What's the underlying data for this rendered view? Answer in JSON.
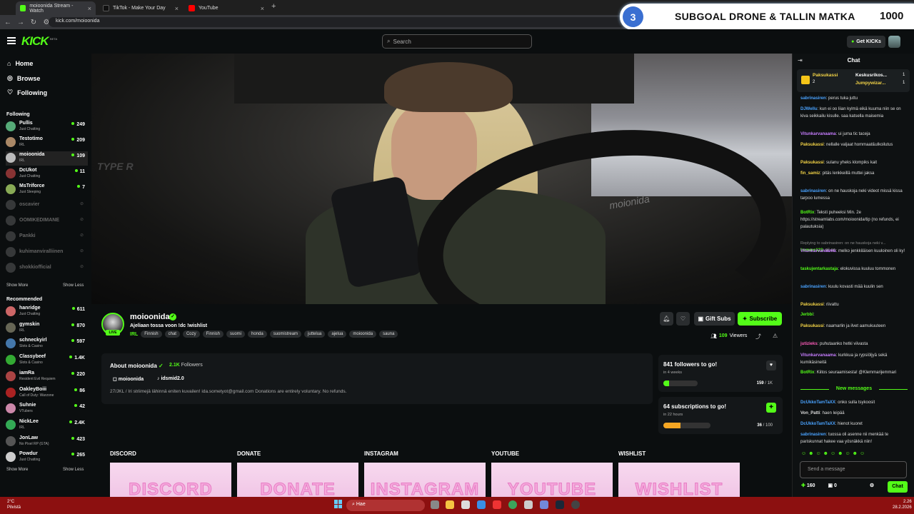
{
  "browser": {
    "tabs": [
      {
        "title": "moioonida Stream - Watch",
        "color": "#53fc18",
        "active": true
      },
      {
        "title": "TikTok - Make Your Day",
        "color": "#111111",
        "active": false
      },
      {
        "title": "YouTube",
        "color": "#ff0000",
        "active": false
      }
    ],
    "url": "kick.com/moioonida",
    "incognito": "Incognito"
  },
  "overlay": {
    "step": "3",
    "text": "SUBGOAL DRONE & TALLIN MATKA",
    "count": "1000"
  },
  "header": {
    "logo": "KICK",
    "beta": "BETA",
    "search_placeholder": "Search",
    "get_kicks": "Get KICKs"
  },
  "sidebar": {
    "nav": [
      {
        "label": "Home",
        "icon": "home-icon"
      },
      {
        "label": "Browse",
        "icon": "compass-icon"
      },
      {
        "label": "Following",
        "icon": "heart-icon"
      }
    ],
    "following_title": "Following",
    "following": [
      {
        "name": "Pullis",
        "category": "Just Chatting",
        "viewers": "249",
        "live": true,
        "color": "#5a7"
      },
      {
        "name": "Testotimo",
        "category": "IRL",
        "viewers": "209",
        "live": true,
        "color": "#a86"
      },
      {
        "name": "moioonida",
        "category": "IRL",
        "viewers": "109",
        "live": true,
        "color": "#bbb",
        "active": true
      },
      {
        "name": "DcUkot",
        "category": "Just Chatting",
        "viewers": "11",
        "live": true,
        "color": "#833"
      },
      {
        "name": "MsTriforce",
        "category": "Just Sleeping",
        "viewers": "7",
        "live": true,
        "color": "#8a5"
      },
      {
        "name": "oscavier",
        "live": false,
        "color": "#777"
      },
      {
        "name": "OOMIKEDIMANE",
        "live": false,
        "color": "#777"
      },
      {
        "name": "Pankki",
        "live": false,
        "color": "#777"
      },
      {
        "name": "kuhimanviralliinen",
        "live": false,
        "color": "#777"
      },
      {
        "name": "shokkiofficial",
        "live": false,
        "color": "#777"
      }
    ],
    "show_more": "Show More",
    "show_less": "Show Less",
    "recommended_title": "Recommended",
    "recommended": [
      {
        "name": "hanridge",
        "category": "Just Chatting",
        "viewers": "611",
        "color": "#c66"
      },
      {
        "name": "gymskin",
        "category": "IRL",
        "viewers": "870",
        "color": "#665"
      },
      {
        "name": "schneckyirl",
        "category": "Slots & Casino",
        "viewers": "597",
        "color": "#47a"
      },
      {
        "name": "Classybeef",
        "category": "Slots & Casino",
        "viewers": "1.4K",
        "color": "#3a3"
      },
      {
        "name": "iamRa",
        "category": "Resident Evil Requiem",
        "viewers": "220",
        "color": "#a44"
      },
      {
        "name": "OakleyBoiii",
        "category": "Call of Duty: Warzone",
        "viewers": "86",
        "color": "#a22"
      },
      {
        "name": "Suhnie",
        "category": "VTubers",
        "viewers": "42",
        "color": "#c8a"
      },
      {
        "name": "NickLee",
        "category": "IRL",
        "viewers": "2.4K",
        "color": "#3a5"
      },
      {
        "name": "JonLaw",
        "category": "No Pixel RP (GTA)",
        "viewers": "423",
        "color": "#555"
      },
      {
        "name": "Powdur",
        "category": "Just Chatting",
        "viewers": "265",
        "color": "#ccc"
      }
    ]
  },
  "video": {
    "seat_text": "TYPE R",
    "wheel_text": "moionida"
  },
  "stream": {
    "name": "moioonida",
    "live": "LIVE",
    "title": "Ajeliaan tossa voon !dc !wishlist",
    "category": "IRL",
    "tags": [
      "Finnish",
      "chat",
      "Cozy",
      "Finnish",
      "suomi",
      "honda",
      "suomistream",
      "juttelua",
      "ajelua",
      "moioonida",
      "sauna"
    ],
    "gift_subs": "Gift Subs",
    "subscribe": "Subscribe",
    "viewers": "109",
    "viewers_label": "Viewers"
  },
  "about": {
    "title": "About moioonida",
    "followers": "2.1K",
    "followers_label": "Followers",
    "instagram": "moioonida",
    "tiktok": "idsmid2.0",
    "description": "27/JKL / Iri striimejä lähinnä eniten kuvailen! ida.sometyot@gmail.com Donations are entirely voluntary. No refunds."
  },
  "goals": [
    {
      "title": "841 followers to go!",
      "sub": "in 4 weeks",
      "current": "159",
      "target": "1K",
      "progress": 0.16,
      "color": "#53fc18",
      "btn": "♥"
    },
    {
      "title": "64 subscriptions to go!",
      "sub": "in 22 hours",
      "current": "36",
      "target": "100",
      "progress": 0.36,
      "color": "#f5a623",
      "btn": "✚"
    }
  ],
  "panels": [
    {
      "title": "DISCORD",
      "art": "DISCORD"
    },
    {
      "title": "DONATE",
      "art": "DONATE"
    },
    {
      "title": "INSTAGRAM",
      "art": "INSTAGRAM"
    },
    {
      "title": "YOUTUBE",
      "art": "YOUTUBE"
    },
    {
      "title": "WISHLIST",
      "art": "WISHLIST"
    }
  ],
  "chat": {
    "title": "Chat",
    "pinned": [
      {
        "user": "Paksukassi",
        "count": "2"
      },
      {
        "user": "Keskusrikos...",
        "count": "1"
      },
      {
        "user": "Jumpywizar...",
        "count": "1"
      }
    ],
    "messages": [
      {
        "user": "sabrinasiren",
        "color": "#4aa3ff",
        "text": "perus tuka juttu"
      },
      {
        "user": "DJWellu",
        "color": "#4aa3ff",
        "text": "kun ei oo liian kylmä eikä kuuma niin se on kiva seikkailu kisulle. saa katsella maisemia"
      },
      {
        "user": "Vitunkarvanaama",
        "color": "#c77dff",
        "text": "ui juma tic taceja"
      },
      {
        "user": "Paksukassi",
        "color": "#f5d547",
        "text": "nellalle valjaat hommaat&ulkoilutus"
      },
      {
        "user": "Paksukassi",
        "color": "#f5d547",
        "text": "sulanu yheks klompiks kait"
      },
      {
        "user": "fin_samiz",
        "color": "#f5d547",
        "text": "pitäs lenkkeillä muttei jaksa"
      },
      {
        "user": "sabrinasiren",
        "color": "#4aa3ff",
        "text": "on ne hauskoja neki videot missä kissa tarpoo lumessa"
      },
      {
        "user": "BotRix",
        "color": "#53fc18",
        "text": "Teksti puheeksi Min. 2e https://streamlabs.com/moioonida/tip (no refunds, ei palautuksia)"
      },
      {
        "user": "hemmo123",
        "color": "#53fc18",
        "text": "nii on",
        "reply": "Replying to sabrinasiren: on ne hauskoja neki v..."
      },
      {
        "user": "Vitunkarvanaama",
        "color": "#c77dff",
        "text": "melko jenkkiläisen kuuloinen oli ky!"
      },
      {
        "user": "taskujentarkastaja",
        "color": "#53fc18",
        "text": "elokuvissa kuuluu tommonen"
      },
      {
        "user": "sabrinasiren",
        "color": "#4aa3ff",
        "text": "kuulu kovasti mää kuulin sen"
      },
      {
        "user": "Paksukassi",
        "color": "#f5d547",
        "text": "riivattu"
      },
      {
        "user": "Jerbbi",
        "color": "#53fc18",
        "text": ""
      },
      {
        "user": "Paksukassi",
        "color": "#f5d547",
        "text": "naamarlin ja ilvet aamukuuteen"
      },
      {
        "user": "jutizieks",
        "color": "#ff5dbb",
        "text": "puhutaanko hetki viivasta"
      },
      {
        "user": "Vitunkarvanaama",
        "color": "#c77dff",
        "text": "kurkkua ja rypsiöljyä sekä kumikäsineitä"
      },
      {
        "user": "BotRix",
        "color": "#53fc18",
        "text": "Kiitos seuraamisesta! @Klemmarijemmari"
      }
    ],
    "new_messages": "New messages",
    "new": [
      {
        "user": "DcUkkoTamTaXX",
        "color": "#4aa3ff",
        "text": "onko sulla tsykoosit"
      },
      {
        "user": "Von_Patti",
        "color": "#ddd",
        "text": "haen leipää"
      },
      {
        "user": "DcUkkoTamTaXX",
        "color": "#4aa3ff",
        "text": "hienot kuoret"
      },
      {
        "user": "sabrinasiren",
        "color": "#4aa3ff",
        "text": "tuossa oli asenne nii menkää te pariskunnat hakee vaa yösnäkkä niin!"
      }
    ],
    "input_placeholder": "Send a message",
    "kicks": "160",
    "gifts": "0",
    "chat_button": "Chat"
  },
  "taskbar": {
    "temp": "2°C",
    "weather": "Pilvistä",
    "search": "Hae",
    "time": "2.26",
    "date": "28.2.2026"
  }
}
